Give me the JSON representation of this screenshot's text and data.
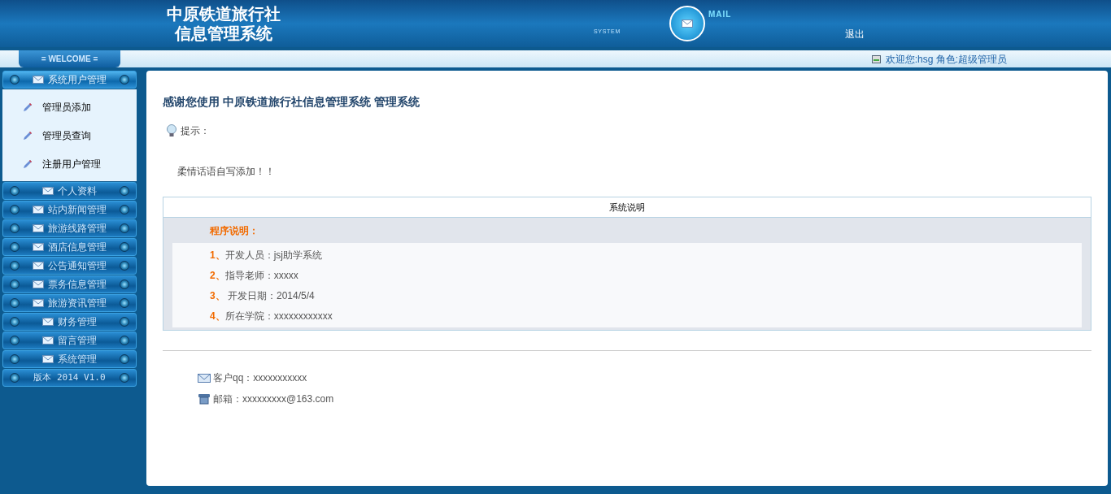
{
  "header": {
    "title_lines": [
      "中原铁道旅行社",
      "信息管理系统"
    ],
    "system_label": "SYSTEM",
    "mail_label": "MAIL",
    "logout": "退出"
  },
  "welcome_bar": {
    "welcome": "= WELCOME =",
    "greeting": "欢迎您:hsg 角色:超级管理员"
  },
  "sidebar": {
    "groups": [
      {
        "kind": "group",
        "label": "系统用户管理",
        "expanded": true,
        "children": [
          {
            "label": "管理员添加"
          },
          {
            "label": "管理员查询"
          },
          {
            "label": "注册用户管理"
          }
        ]
      },
      {
        "kind": "group",
        "label": "个人资料",
        "expanded": false
      },
      {
        "kind": "group",
        "label": "站内新闻管理",
        "expanded": false
      },
      {
        "kind": "group",
        "label": "旅游线路管理",
        "expanded": false
      },
      {
        "kind": "group",
        "label": "酒店信息管理",
        "expanded": false
      },
      {
        "kind": "group",
        "label": "公告通知管理",
        "expanded": false
      },
      {
        "kind": "group",
        "label": "票务信息管理",
        "expanded": false
      },
      {
        "kind": "group",
        "label": "旅游资讯管理",
        "expanded": false
      },
      {
        "kind": "group",
        "label": "财务管理",
        "expanded": false
      },
      {
        "kind": "group",
        "label": "留言管理",
        "expanded": false
      },
      {
        "kind": "group",
        "label": "系统管理",
        "expanded": false
      },
      {
        "kind": "version",
        "label": "版本 2014 V1.0"
      }
    ]
  },
  "content": {
    "heading": "感谢您使用 中原铁道旅行社信息管理系统 管理系统",
    "tip_label": "提示：",
    "message": "柔情话语自写添加！！",
    "info_table": {
      "title": "系统说明",
      "subtitle": "程序说明：",
      "rows": [
        {
          "number": "1、",
          "text": "开发人员：jsj助学系统"
        },
        {
          "number": "2、",
          "text": "指导老师：xxxxx"
        },
        {
          "number": "3、",
          "text": " 开发日期：2014/5/4"
        },
        {
          "number": "4、",
          "text": "所在学院：xxxxxxxxxxxx"
        }
      ]
    },
    "contacts": [
      {
        "kind": "qq",
        "text": "客户qq：xxxxxxxxxxx"
      },
      {
        "kind": "phone",
        "text": "邮箱：xxxxxxxxx@163.com"
      }
    ]
  }
}
